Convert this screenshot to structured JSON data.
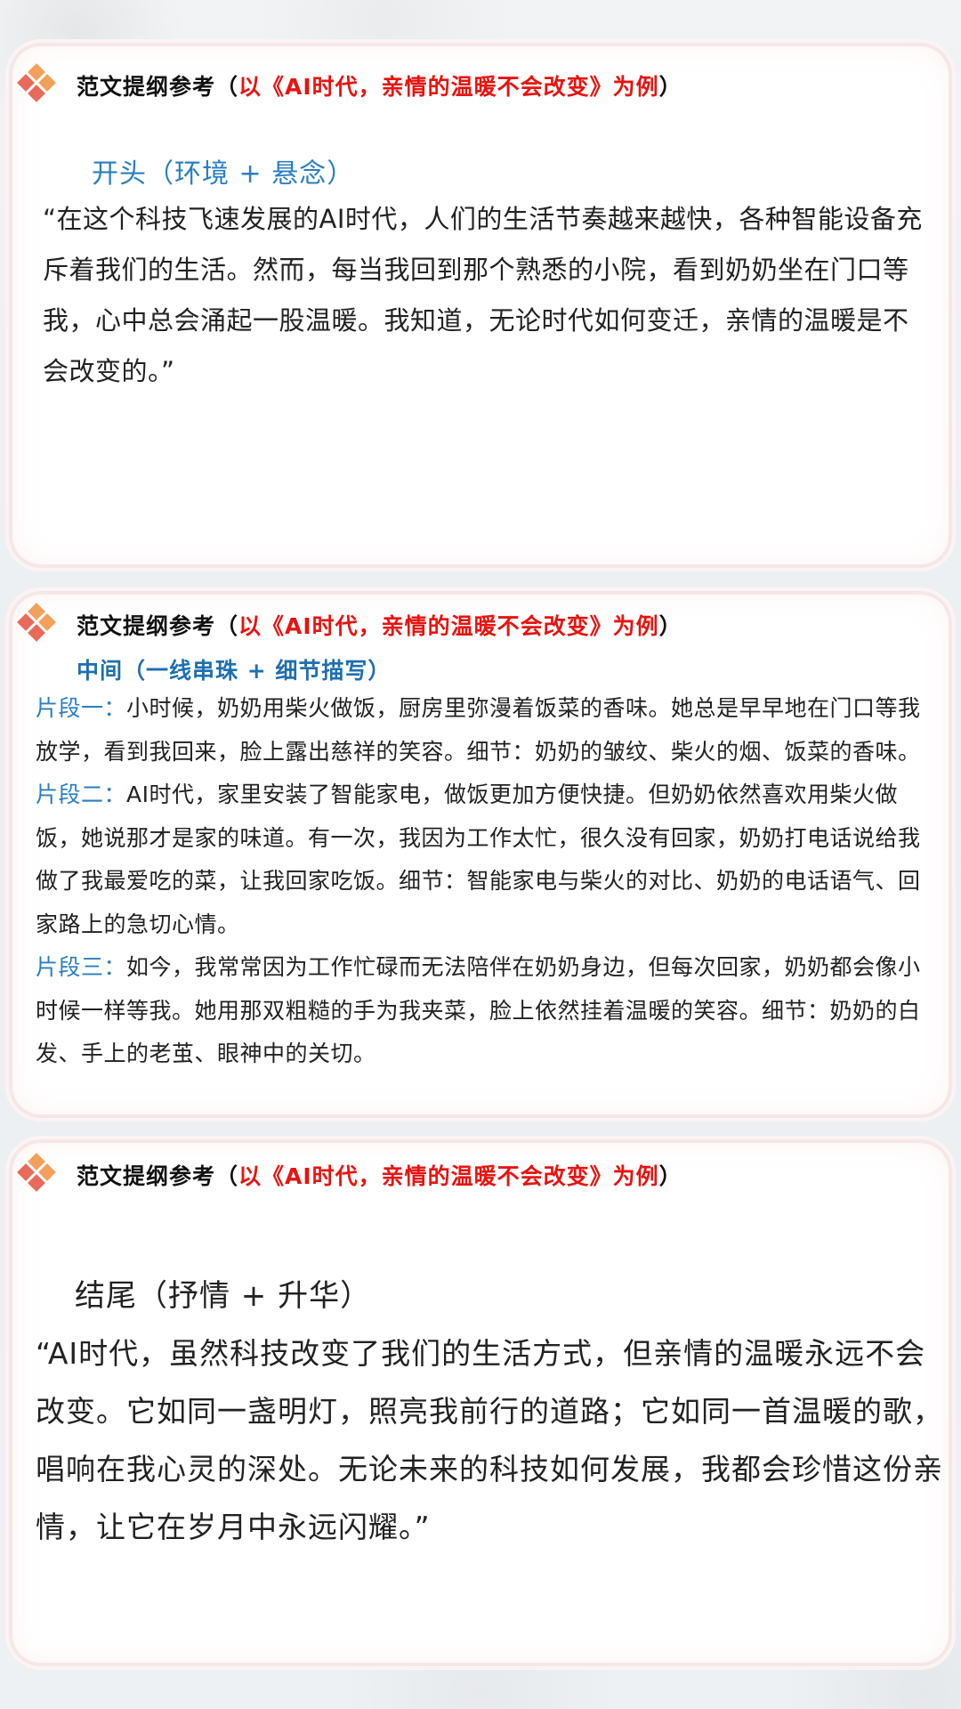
{
  "colors": {
    "accent_blue": "#2a7fc0",
    "accent_red": "#e8130f",
    "logo_orange": "#f2a05a",
    "logo_red": "#e86a5a"
  },
  "header": {
    "prefix": "范文提纲参考（",
    "red": "以《AI时代，亲情的温暖不会改变》为例",
    "suffix": "）"
  },
  "opening": {
    "title": "开头（环境 + 悬念）",
    "body": "“在这个科技飞速发展的AI时代，人们的生活节奏越来越快，各种智能设备充斥着我们的生活。然而，每当我回到那个熟悉的小院，看到奶奶坐在门口等我，心中总会涌起一股温暖。我知道，无论时代如何变迁，亲情的温暖是不会改变的。”"
  },
  "middle": {
    "title": "中间（一线串珠 + 细节描写）",
    "fragments": [
      {
        "label": "片段一：",
        "text": "小时候，奶奶用柴火做饭，厨房里弥漫着饭菜的香味。她总是早早地在门口等我放学，看到我回来，脸上露出慈祥的笑容。细节：奶奶的皱纹、柴火的烟、饭菜的香味。"
      },
      {
        "label": "片段二：",
        "text": "AI时代，家里安装了智能家电，做饭更加方便快捷。但奶奶依然喜欢用柴火做饭，她说那才是家的味道。有一次，我因为工作太忙，很久没有回家，奶奶打电话说给我做了我最爱吃的菜，让我回家吃饭。细节：智能家电与柴火的对比、奶奶的电话语气、回家路上的急切心情。"
      },
      {
        "label": "片段三：",
        "text": "如今，我常常因为工作忙碌而无法陪伴在奶奶身边，但每次回家，奶奶都会像小时候一样等我。她用那双粗糙的手为我夹菜，脸上依然挂着温暖的笑容。细节：奶奶的白发、手上的老茧、眼神中的关切。"
      }
    ]
  },
  "ending": {
    "title": "结尾（抒情 + 升华）",
    "body": "“AI时代，虽然科技改变了我们的生活方式，但亲情的温暖永远不会改变。它如同一盏明灯，照亮我前行的道路；它如同一首温暖的歌，唱响在我心灵的深处。无论未来的科技如何发展，我都会珍惜这份亲情，让它在岁月中永远闪耀。”"
  }
}
